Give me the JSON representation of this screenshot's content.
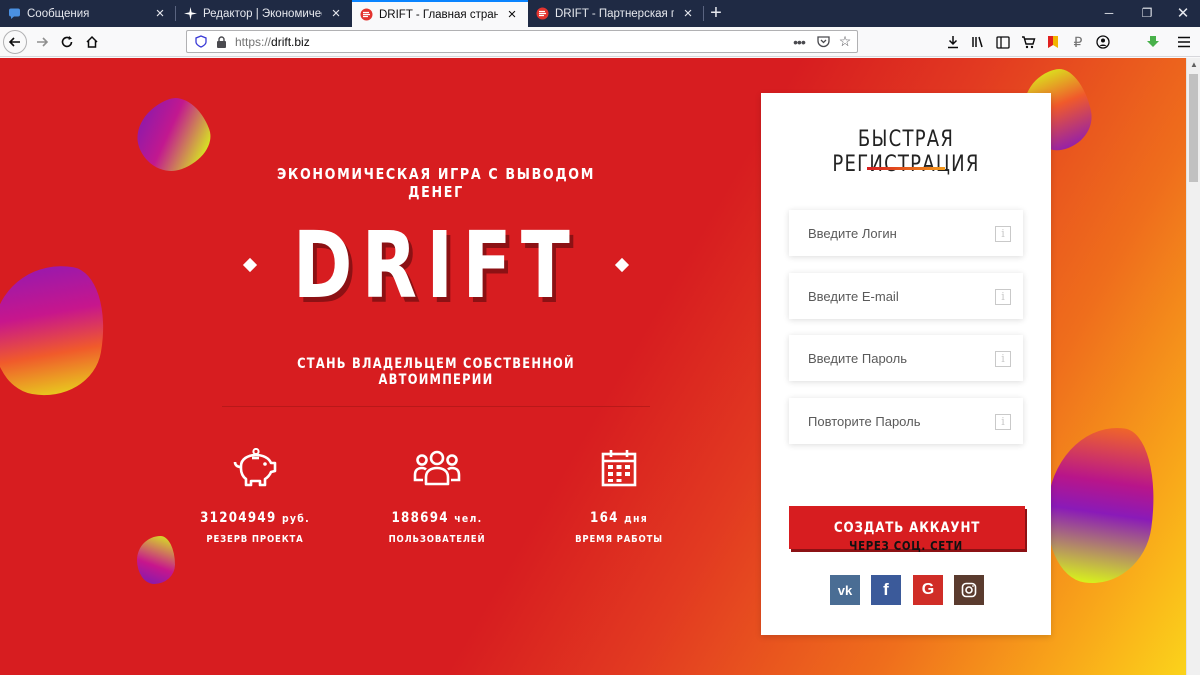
{
  "browser": {
    "tabs": [
      {
        "title": "Сообщения",
        "icon": "chat-icon",
        "color": "#4a90e2"
      },
      {
        "title": "Редактор | Экономическая игр",
        "icon": "sparkle-icon",
        "color": "#ffffff"
      },
      {
        "title": "DRIFT - Главная страница",
        "icon": "drift-logo-icon",
        "color": "#e3342f",
        "active": true
      },
      {
        "title": "DRIFT - Партнерская програм",
        "icon": "drift-logo-icon",
        "color": "#e3342f"
      }
    ],
    "url_protocol": "https://",
    "url_host": "drift.biz"
  },
  "hero": {
    "subtitle": "ЭКОНОМИЧЕСКАЯ ИГРА С ВЫВОДОМ ДЕНЕГ",
    "title": "DRIFT",
    "tagline": "СТАНЬ ВЛАДЕЛЬЦЕМ СОБСТВЕННОЙ АВТОИМПЕРИИ"
  },
  "stats": [
    {
      "icon": "piggy-bank-icon",
      "value": "31204949",
      "unit": "руб.",
      "label": "РЕЗЕРВ ПРОЕКТА"
    },
    {
      "icon": "users-icon",
      "value": "188694",
      "unit": "чел.",
      "label": "ПОЛЬЗОВАТЕЛЕЙ"
    },
    {
      "icon": "calendar-icon",
      "value": "164",
      "unit": "дня",
      "label": "ВРЕМЯ РАБОТЫ"
    }
  ],
  "registration": {
    "title": "БЫСТРАЯ РЕГИСТРАЦИЯ",
    "fields": [
      {
        "placeholder": "Введите Логин"
      },
      {
        "placeholder": "Введите E-mail"
      },
      {
        "placeholder": "Введите Пароль"
      },
      {
        "placeholder": "Повторите Пароль"
      }
    ],
    "submit": "СОЗДАТЬ АККАУНТ",
    "social_label": "ЧЕРЕЗ СОЦ. СЕТИ",
    "social": [
      {
        "name": "vk",
        "glyph": "vk",
        "color": "#4a6d94"
      },
      {
        "name": "facebook",
        "glyph": "f",
        "color": "#3b5a9a"
      },
      {
        "name": "google",
        "glyph": "G",
        "color": "#d02d27"
      },
      {
        "name": "instagram",
        "glyph": "◎",
        "color": "#5a3b2e"
      }
    ]
  }
}
